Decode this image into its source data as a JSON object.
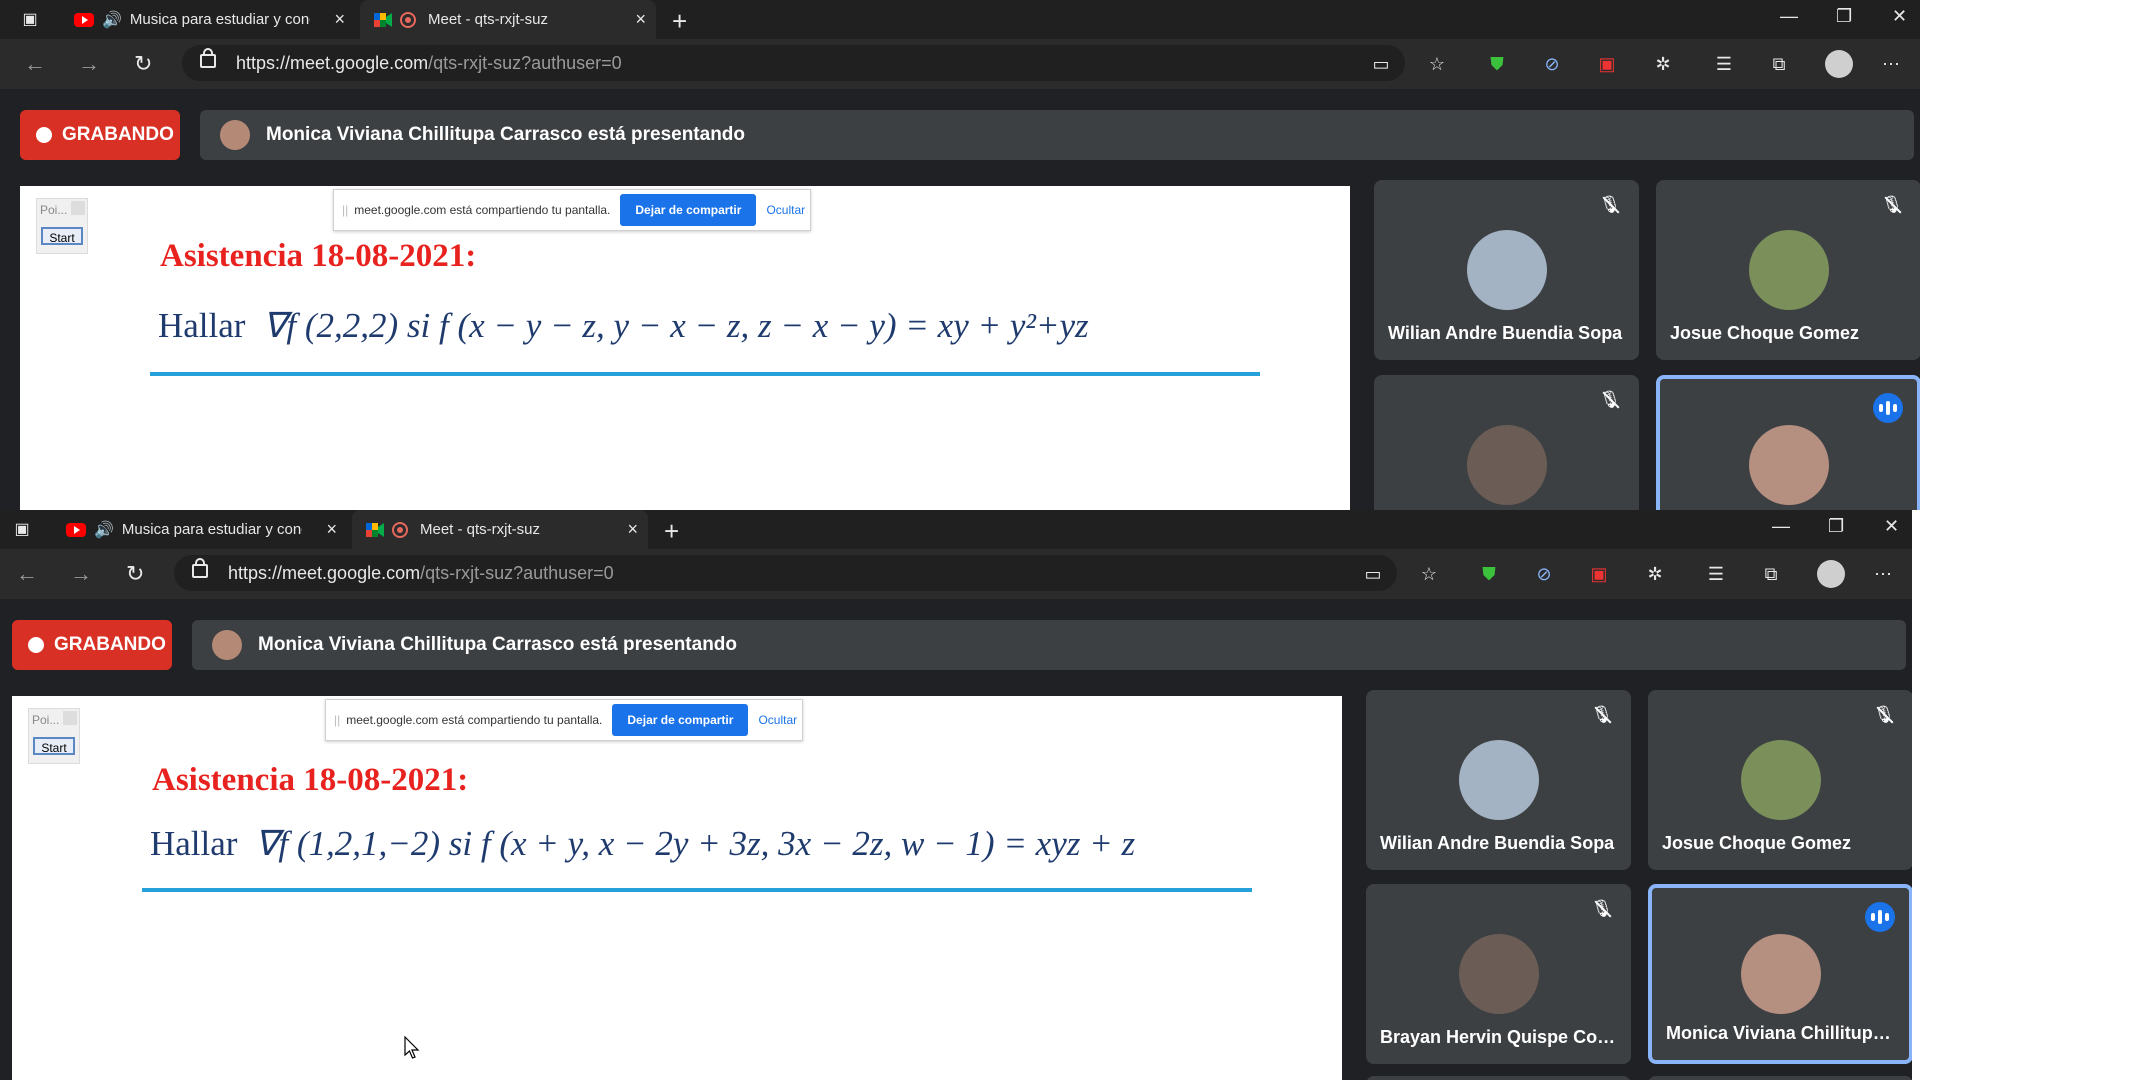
{
  "browser": {
    "tabs": [
      {
        "title": "Musica para estudiar y concentrarse",
        "close": "×"
      },
      {
        "title": "Meet - qts-rxjt-suz",
        "close": "×"
      }
    ],
    "new_tab": "+",
    "url_host": "https://meet.google.com",
    "url_path": "/qts-rxjt-suz?authuser=0",
    "window_controls": {
      "minimize": "—",
      "restore": "❐",
      "close": "✕"
    }
  },
  "meet": {
    "recording_label": "GRABANDO",
    "presenting_text": "Monica Viviana Chillitupa Carrasco está presentando",
    "share_bar": {
      "message": "meet.google.com está compartiendo tu pantalla.",
      "stop_label": "Dejar de compartir",
      "hide_label": "Ocultar"
    },
    "widget": {
      "title": "Poi...",
      "start_label": "Start"
    }
  },
  "screens": [
    {
      "slide_title": "Asistencia 18-08-2021:",
      "equation_word": "Hallar",
      "equation": "∇f (2,2,2) si f (x − y − z, y − x − z, z − x − y) = xy + y²+yz",
      "participants": [
        {
          "name": "Wilian Andre Buendia Sopa",
          "muted": true
        },
        {
          "name": "Josue Choque Gomez",
          "muted": true
        },
        {
          "name": "",
          "muted": true
        },
        {
          "name": "",
          "speaking": true
        }
      ]
    },
    {
      "slide_title": "Asistencia 18-08-2021:",
      "equation_word": "Hallar",
      "equation": "∇f (1,2,1,−2) si f (x + y, x − 2y + 3z, 3x − 2z, w − 1) = xyz + z",
      "participants": [
        {
          "name": "Wilian Andre Buendia Sopa",
          "muted": true
        },
        {
          "name": "Josue Choque Gomez",
          "muted": true
        },
        {
          "name": "Brayan Hervin Quispe Cos...",
          "muted": true
        },
        {
          "name": "Monica Viviana Chillitupa ...",
          "speaking": true
        }
      ]
    }
  ],
  "colors": {
    "record": "#d93025",
    "accent": "#1a73e8",
    "speaking_border": "#8ab4f8",
    "slide_title": "#e8221e"
  }
}
